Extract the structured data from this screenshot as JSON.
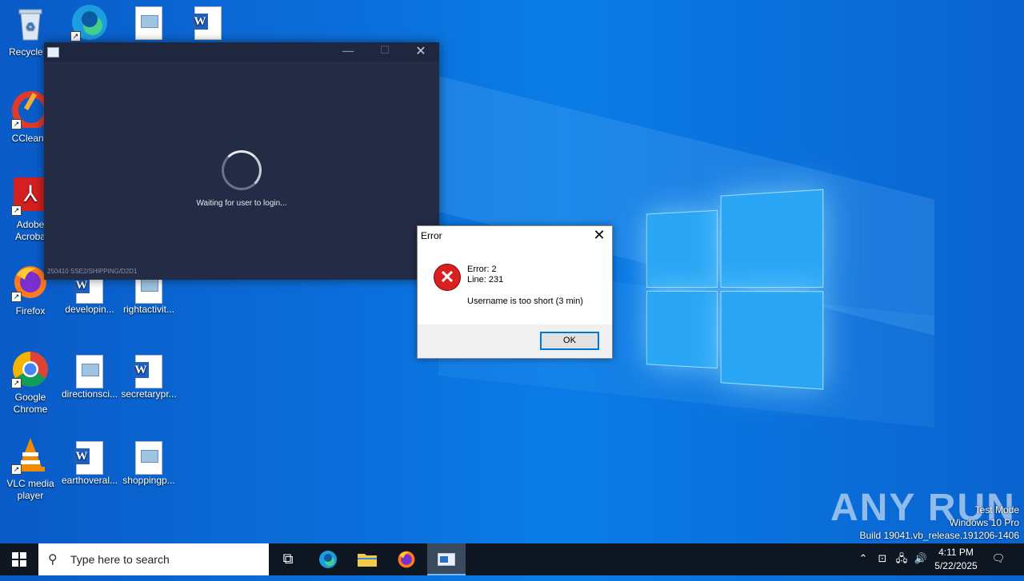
{
  "desktop_icons": [
    {
      "label": "Recycle Bin",
      "display": "Recycle B"
    },
    {
      "label": "CCleaner",
      "display": "CCleane"
    },
    {
      "label": "Adobe Acrobat",
      "display": "Adobe Acroba"
    },
    {
      "label": "Firefox",
      "display": "Firefox"
    },
    {
      "label": "Google Chrome",
      "display": "Google Chrome"
    },
    {
      "label": "VLC media player",
      "display": "VLC media player"
    },
    {
      "label": "developin...",
      "display": "developin..."
    },
    {
      "label": "rightactivit...",
      "display": "rightactivit..."
    },
    {
      "label": "directionsci...",
      "display": "directionsci..."
    },
    {
      "label": "secretarypr...",
      "display": "secretarypr..."
    },
    {
      "label": "earthoveral...",
      "display": "earthoveral..."
    },
    {
      "label": "shoppingp...",
      "display": "shoppingp..."
    }
  ],
  "app_window": {
    "status_text": "Waiting for user to login...",
    "build_text": "250410 SSE2/SHIPPING/D2D1",
    "minimize_glyph": "—",
    "maximize_glyph": "☐",
    "close_glyph": "✕"
  },
  "error_dialog": {
    "title": "Error",
    "close_glyph": "✕",
    "line1": "Error: 2",
    "line2": "Line: 231",
    "message": "Username is too short (3 min)",
    "ok_label": "OK",
    "icon_glyph": "✕"
  },
  "watermark": {
    "line1": "Test Mode",
    "line2": "Windows 10 Pro",
    "line3": "Build 19041.vb_release.191206-1406",
    "brand": "ANY RUN"
  },
  "taskbar": {
    "search_placeholder": "Type here to search",
    "time": "4:11 PM",
    "date": "5/22/2025"
  },
  "colors": {
    "desktop_accent": "#0a6fdb",
    "taskbar": "#0e1621",
    "app_window_bg": "#232b45"
  }
}
